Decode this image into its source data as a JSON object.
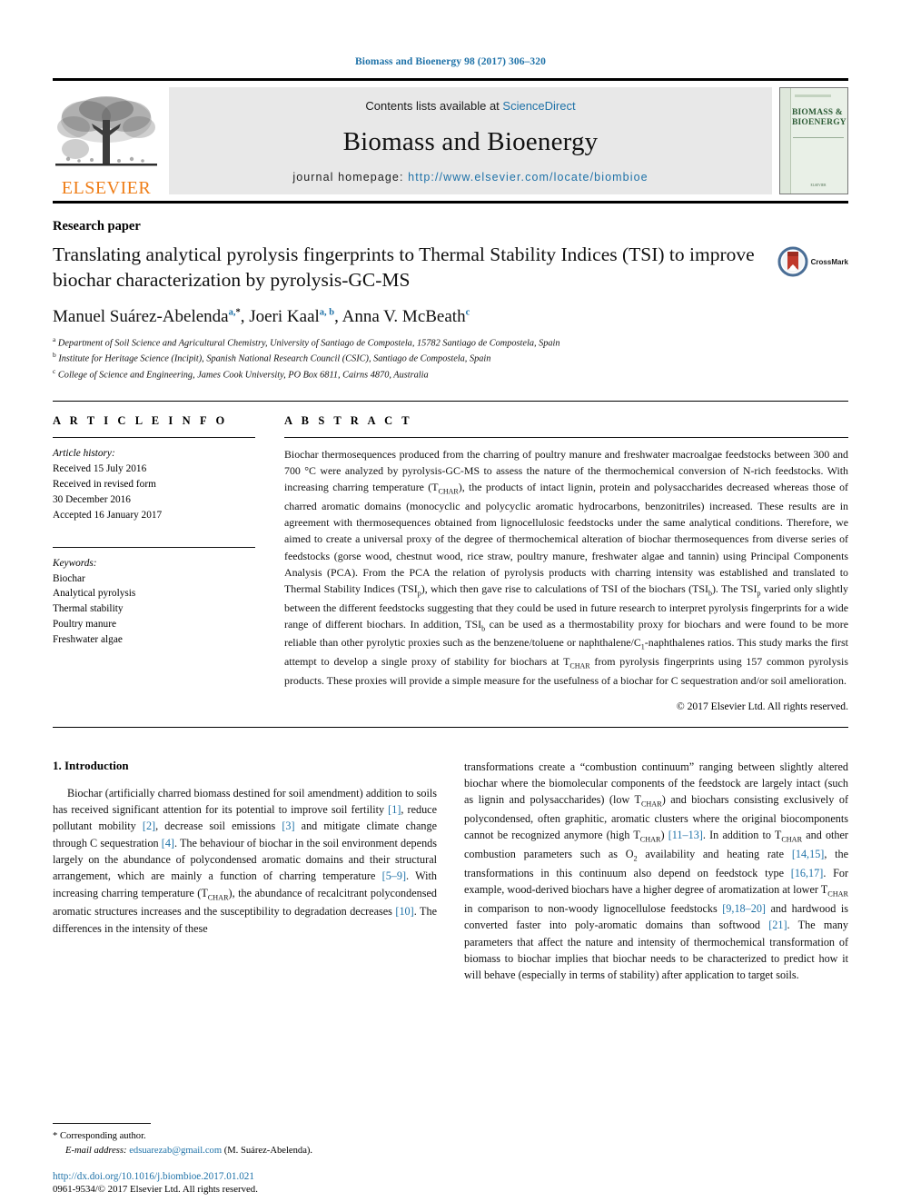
{
  "running_head": "Biomass and Bioenergy 98 (2017) 306–320",
  "masthead": {
    "publisher_name": "ELSEVIER",
    "contents_prefix": "Contents lists available at ",
    "contents_link": "ScienceDirect",
    "journal_name": "Biomass and Bioenergy",
    "homepage_prefix": "journal homepage: ",
    "homepage_url": "http://www.elsevier.com/locate/biombioe",
    "cover": {
      "title_line1": "BIOMASS &",
      "title_line2": "BIOENERGY",
      "publisher": "ELSEVIER"
    }
  },
  "article": {
    "type": "Research paper",
    "title": "Translating analytical pyrolysis fingerprints to Thermal Stability Indices (TSI) to improve biochar characterization by pyrolysis-GC-MS",
    "crossmark_label": "CrossMark",
    "authors": [
      {
        "name": "Manuel Suárez-Abelenda",
        "sup": "a,",
        "star": "*",
        "sep": ", "
      },
      {
        "name": "Joeri Kaal",
        "sup": "a, b",
        "star": "",
        "sep": ", "
      },
      {
        "name": "Anna V. McBeath",
        "sup": "c",
        "star": "",
        "sep": ""
      }
    ],
    "affiliations": [
      {
        "mark": "a",
        "text": "Department of Soil Science and Agricultural Chemistry, University of Santiago de Compostela, 15782 Santiago de Compostela, Spain"
      },
      {
        "mark": "b",
        "text": "Institute for Heritage Science (Incipit), Spanish National Research Council (CSIC), Santiago de Compostela, Spain"
      },
      {
        "mark": "c",
        "text": "College of Science and Engineering, James Cook University, PO Box 6811, Cairns 4870, Australia"
      }
    ]
  },
  "article_info": {
    "heading": "A R T I C L E  I N F O",
    "history_label": "Article history:",
    "history": [
      "Received 15 July 2016",
      "Received in revised form",
      "30 December 2016",
      "Accepted 16 January 2017"
    ],
    "keywords_label": "Keywords:",
    "keywords": [
      "Biochar",
      "Analytical pyrolysis",
      "Thermal stability",
      "Poultry manure",
      "Freshwater algae"
    ]
  },
  "abstract": {
    "heading": "A B S T R A C T",
    "paragraphs": [
      "Biochar thermosequences produced from the charring of poultry manure and freshwater macroalgae feedstocks between 300 and 700 °C were analyzed by pyrolysis-GC-MS to assess the nature of the thermochemical conversion of N-rich feedstocks. With increasing charring temperature (T_CHAR), the products of intact lignin, protein and polysaccharides decreased whereas those of charred aromatic domains (monocyclic and polycyclic aromatic hydrocarbons, benzonitriles) increased. These results are in agreement with thermosequences obtained from lignocellulosic feedstocks under the same analytical conditions. Therefore, we aimed to create a universal proxy of the degree of thermochemical alteration of biochar thermosequences from diverse series of feedstocks (gorse wood, chestnut wood, rice straw, poultry manure, freshwater algae and tannin) using Principal Components Analysis (PCA). From the PCA the relation of pyrolysis products with charring intensity was established and translated to Thermal Stability Indices (TSI_p), which then gave rise to calculations of TSI of the biochars (TSI_b). The TSI_p varied only slightly between the different feedstocks suggesting that they could be used in future research to interpret pyrolysis fingerprints for a wide range of different biochars. In addition, TSI_b can be used as a thermostability proxy for biochars and were found to be more reliable than other pyrolytic proxies such as the benzene/toluene or naphthalene/C_1-naphthalenes ratios. This study marks the first attempt to develop a single proxy of stability for biochars at T_CHAR from pyrolysis fingerprints using 157 common pyrolysis products. These proxies will provide a simple measure for the usefulness of a biochar for C sequestration and/or soil amelioration."
    ],
    "copyright": "© 2017 Elsevier Ltd. All rights reserved."
  },
  "introduction": {
    "number": "1.",
    "heading": "Introduction",
    "left_text_parts": [
      {
        "t": "Biochar (artificially charred biomass destined for soil amendment) addition to soils has received significant attention for its potential to improve soil fertility "
      },
      {
        "c": "[1]"
      },
      {
        "t": ", reduce pollutant mobility "
      },
      {
        "c": "[2]"
      },
      {
        "t": ", decrease soil emissions "
      },
      {
        "c": "[3]"
      },
      {
        "t": " and mitigate climate change through C sequestration "
      },
      {
        "c": "[4]"
      },
      {
        "t": ". The behaviour of biochar in the soil environment depends largely on the abundance of polycondensed aromatic domains and their structural arrangement, which are mainly a function of charring temperature "
      },
      {
        "c": "[5–9]"
      },
      {
        "t": ". With increasing charring temperature (T"
      },
      {
        "sub": "CHAR"
      },
      {
        "t": "), the abundance of recalcitrant polycondensed aromatic structures increases and the susceptibility to degradation decreases "
      },
      {
        "c": "[10]"
      },
      {
        "t": ". The differences in the intensity of these"
      }
    ],
    "right_text_parts": [
      {
        "t": "transformations create a “combustion continuum” ranging between slightly altered biochar where the biomolecular components of the feedstock are largely intact (such as lignin and polysaccharides) (low T"
      },
      {
        "sub": "CHAR"
      },
      {
        "t": ") and biochars consisting exclusively of polycondensed, often graphitic, aromatic clusters where the original biocomponents cannot be recognized anymore (high T"
      },
      {
        "sub": "CHAR"
      },
      {
        "t": ") "
      },
      {
        "c": "[11–13]"
      },
      {
        "t": ". In addition to T"
      },
      {
        "sub": "CHAR"
      },
      {
        "t": " and other combustion parameters such as O"
      },
      {
        "sub": "2"
      },
      {
        "t": " availability and heating rate "
      },
      {
        "c": "[14,15]"
      },
      {
        "t": ", the transformations in this continuum also depend on feedstock type "
      },
      {
        "c": "[16,17]"
      },
      {
        "t": ". For example, wood-derived biochars have a higher degree of aromatization at lower T"
      },
      {
        "sub": "CHAR"
      },
      {
        "t": " in comparison to non-woody lignocellulose feedstocks "
      },
      {
        "c": "[9,18–20]"
      },
      {
        "t": " and hardwood is converted faster into poly-aromatic domains than softwood "
      },
      {
        "c": "[21]"
      },
      {
        "t": ". The many parameters that affect the nature and intensity of thermochemical transformation of biomass to biochar implies that biochar needs to be characterized to predict how it will behave (especially in terms of stability) after application to target soils."
      }
    ]
  },
  "footnotes": {
    "corresponding_marker": "*",
    "corresponding_text": "Corresponding author.",
    "email_label": "E-mail address:",
    "email": "edsuarezab@gmail.com",
    "email_suffix": "(M. Suárez-Abelenda)."
  },
  "footer": {
    "doi": "http://dx.doi.org/10.1016/j.biombioe.2017.01.021",
    "issn_line": "0961-9534/© 2017 Elsevier Ltd. All rights reserved."
  },
  "colors": {
    "link": "#1f72a8",
    "elsevier_orange": "#ef7d17",
    "cover_green": "#2d5c36"
  }
}
